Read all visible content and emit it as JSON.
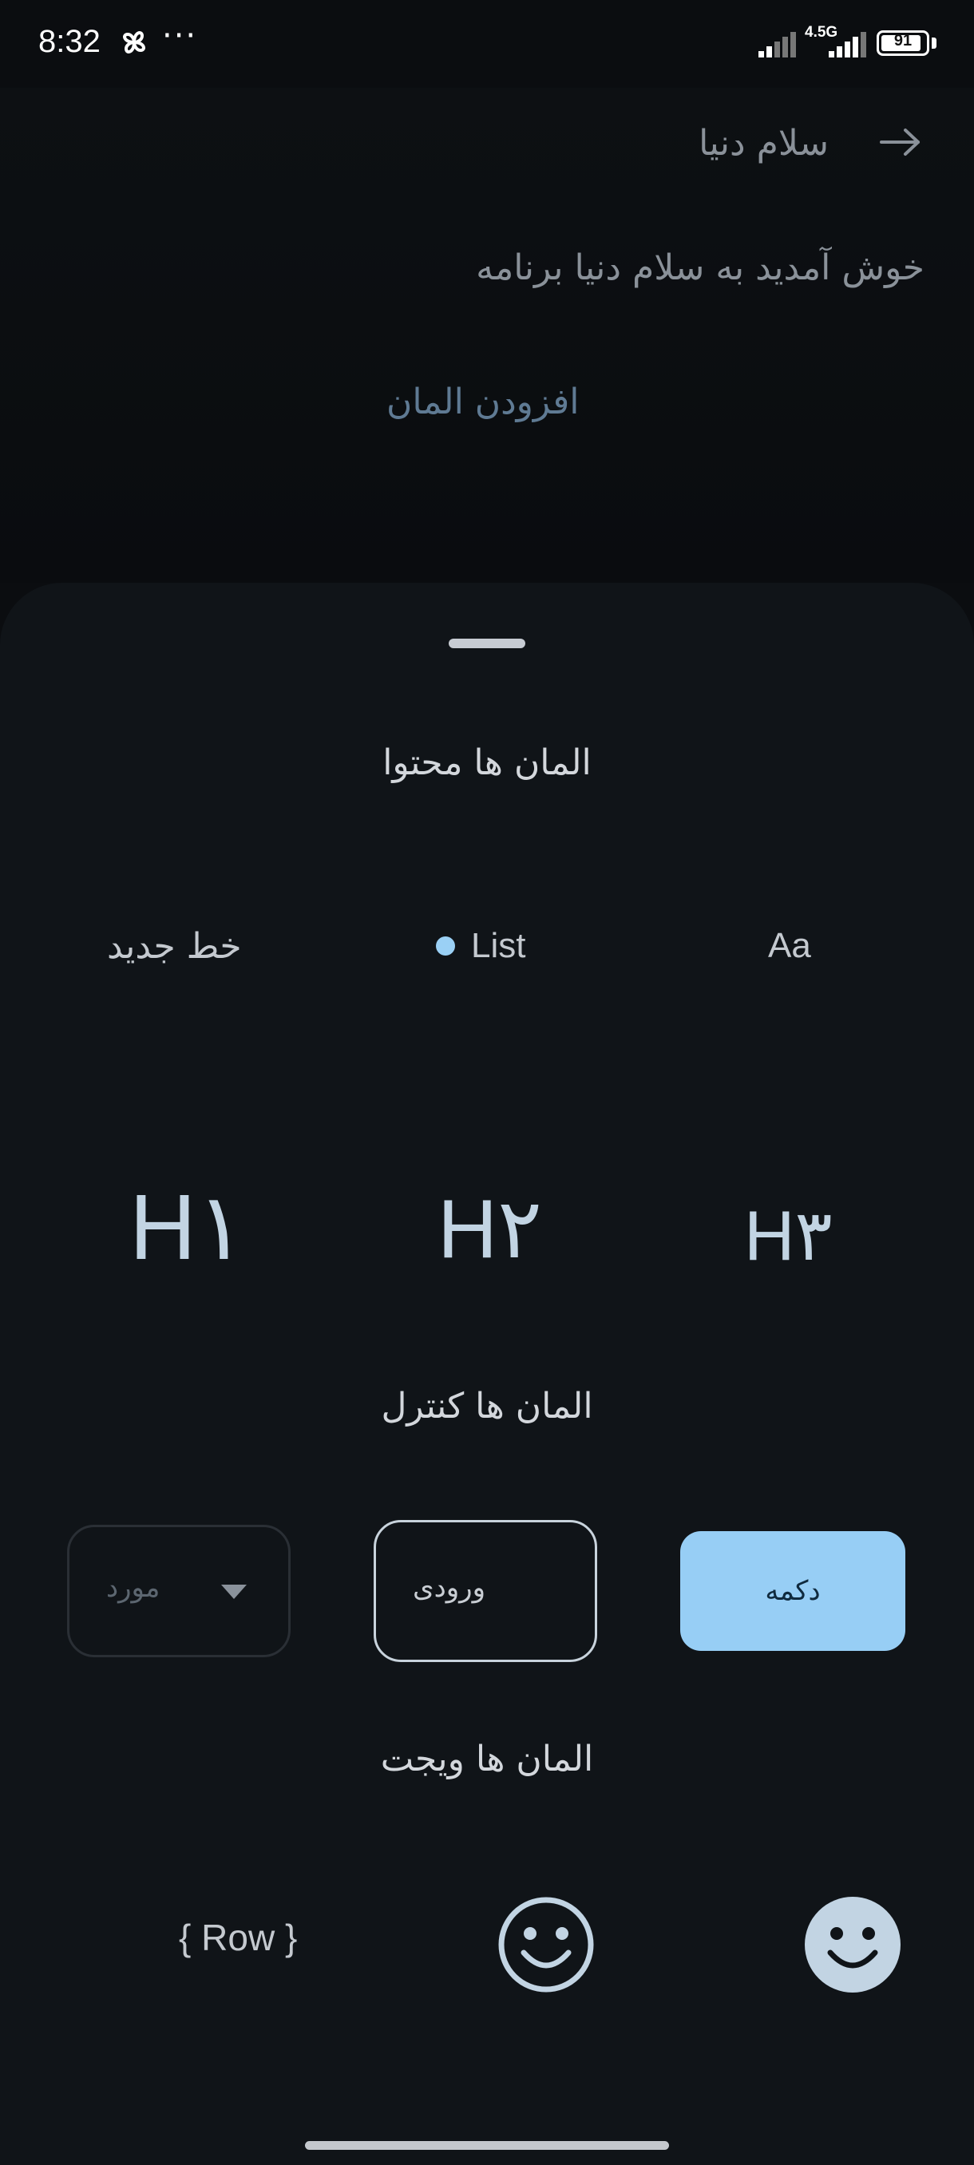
{
  "status_bar": {
    "time": "8:32",
    "more": "···",
    "network": "4.5G",
    "battery": "91",
    "battery_level": 0.91
  },
  "app": {
    "title": "سلام دنیا",
    "welcome": "خوش آمدید به سلام دنیا برنامه",
    "add_element": "افزودن المان"
  },
  "sheet": {
    "content_title": "المان ها محتوا",
    "content_items": {
      "new_line": "خط جدید",
      "list": "List",
      "text_style": "Aa"
    },
    "headings": [
      "H۱",
      "H۲",
      "H۳"
    ],
    "controls_title": "المان ها کنترل",
    "controls": {
      "select_placeholder": "مورد",
      "input_label": "ورودی",
      "button_label": "دکمه"
    },
    "widgets_title": "المان ها ویجت",
    "widgets": {
      "row": "{ Row }"
    }
  },
  "colors": {
    "accent": "#97cef5",
    "sheet_bg": "#101418",
    "heading": "#c2d4e3"
  }
}
